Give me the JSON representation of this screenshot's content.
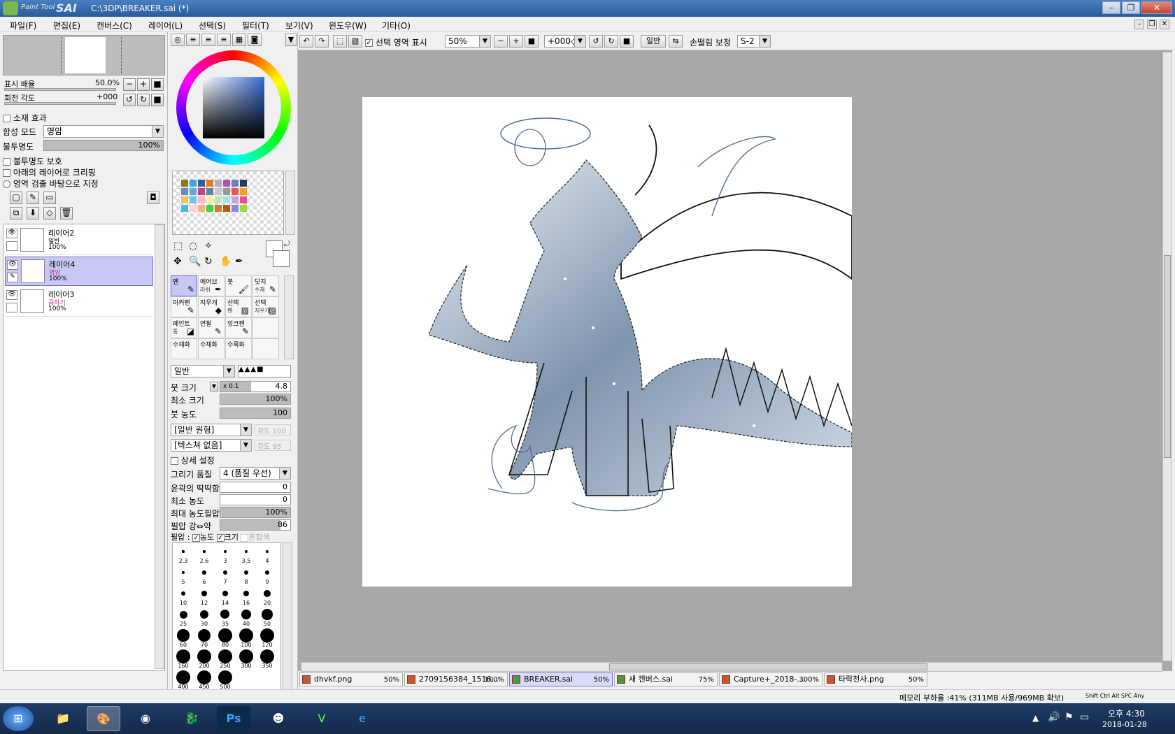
{
  "window": {
    "app": "SAI",
    "app_prefix": "Paint Tool",
    "path": "C:\\3DP\\BREAKER.sai (*)",
    "minimize": "–",
    "maximize": "❐",
    "close": "✕"
  },
  "menu": [
    "파일(F)",
    "편집(E)",
    "캔버스(C)",
    "레이어(L)",
    "선택(S)",
    "필터(T)",
    "보기(V)",
    "윈도우(W)",
    "기타(O)"
  ],
  "navigator": {
    "zoom_label": "표시 배율",
    "zoom_value": "50.0%",
    "rotate_label": "회전 각도",
    "rotate_value": "+000"
  },
  "layer_props": {
    "effects_label": "소재 효과",
    "blend_label": "합성 모드",
    "blend_value": "명암",
    "opacity_label": "불투명도",
    "opacity_value": "100%",
    "opacity_fraction": 1.0,
    "protect_label": "불투명도 보호",
    "clip_label": "아래의 레이어로 크리핑",
    "select_source_label": "영역 검출 바탕으로 지정"
  },
  "layers": [
    {
      "name": "레이어2",
      "mode": "일반",
      "opacity": "100%",
      "active": false
    },
    {
      "name": "레이어4",
      "mode": "명암",
      "opacity": "100%",
      "active": true
    },
    {
      "name": "레이어3",
      "mode": "곱하기",
      "opacity": "100%",
      "active": false
    }
  ],
  "tools": [
    {
      "label": "펜",
      "sub": "",
      "icon": "✎",
      "active": true
    },
    {
      "label": "에어브",
      "sub": "러쉬",
      "icon": "✒",
      "active": false
    },
    {
      "label": "붓",
      "sub": "",
      "icon": "🖌",
      "active": false
    },
    {
      "label": "닷지",
      "sub": "수채",
      "icon": "✎",
      "active": false
    },
    {
      "label": "마커펜",
      "sub": "",
      "icon": "✎",
      "active": false
    },
    {
      "label": "지우개",
      "sub": "",
      "icon": "◆",
      "active": false
    },
    {
      "label": "선택",
      "sub": "펜",
      "icon": "▨",
      "active": false
    },
    {
      "label": "선택",
      "sub": "지우개",
      "icon": "▨",
      "active": false
    },
    {
      "label": "페인트",
      "sub": "통",
      "icon": "◪",
      "active": false
    },
    {
      "label": "연필",
      "sub": "",
      "icon": "✎",
      "active": false
    },
    {
      "label": "잉크펜",
      "sub": "",
      "icon": "✎",
      "active": false
    },
    {
      "label": "",
      "sub": "",
      "icon": "",
      "active": false
    },
    {
      "label": "수채화",
      "sub": "",
      "icon": "",
      "active": false
    },
    {
      "label": "수채화",
      "sub": "",
      "icon": "",
      "active": false
    },
    {
      "label": "수묵화",
      "sub": "",
      "icon": "",
      "active": false
    },
    {
      "label": "",
      "sub": "",
      "icon": "",
      "active": false
    }
  ],
  "brush": {
    "mode": "일반",
    "size_label": "붓 크기",
    "size_mult": "x 0.1",
    "size_value": "4.8",
    "min_size_label": "최소 크기",
    "min_size_value": "100%",
    "density_label": "붓 농도",
    "density_value": "100",
    "shape": "[일반 원형]",
    "shape_strength_label": "강도",
    "shape_strength": "100",
    "texture": "[텍스쳐 없음]",
    "texture_strength_label": "강도",
    "texture_strength": "95",
    "detail_label": "상세 설정",
    "quality_label": "그리기 품질",
    "quality_value": "4 (품질 우선)",
    "edge_label": "윤곽의 딱딱함",
    "edge_value": "0",
    "min_density_label": "최소 농도",
    "min_density_value": "0",
    "max_pressure_label": "최대 농도필압",
    "max_pressure_value": "100%",
    "pressure_label": "필압 강⇔약",
    "pressure_value": "86",
    "pressure_fraction": 0.86,
    "pressure_opts_label": "필압 :",
    "pressure_density": "농도",
    "pressure_size": "크기",
    "pressure_mix": "혼합색"
  },
  "brush_sizes": [
    "2.3",
    "2.6",
    "3",
    "3.5",
    "4",
    "5",
    "6",
    "7",
    "8",
    "9",
    "10",
    "12",
    "14",
    "16",
    "20",
    "25",
    "30",
    "35",
    "40",
    "50",
    "60",
    "70",
    "80",
    "100",
    "120",
    "160",
    "200",
    "250",
    "300",
    "350",
    "400",
    "450",
    "500"
  ],
  "canvas_toolbar": {
    "show_selection": "선택 영역 표시",
    "zoom": "50%",
    "rotate": "+000◇",
    "mode": "일반",
    "stabilizer_label": "손떨림 보정",
    "stabilizer_value": "S-2"
  },
  "file_tabs": [
    {
      "name": "dhvkf.png",
      "zoom": "50%",
      "active": false
    },
    {
      "name": "2709156384_1516...",
      "zoom": "100%",
      "active": false
    },
    {
      "name": "BREAKER.sai",
      "zoom": "50%",
      "active": true
    },
    {
      "name": "새 캔버스.sai",
      "zoom": "75%",
      "active": false
    },
    {
      "name": "Capture+_2018-...",
      "zoom": "300%",
      "active": false
    },
    {
      "name": "타락천사.png",
      "zoom": "50%",
      "active": false
    }
  ],
  "status": {
    "memory": "메모리 부하율 :41% (311MB 사용/969MB 확보)",
    "keys": [
      "Shift",
      "Ctrl",
      "Alt",
      "SPC",
      "Any"
    ]
  },
  "taskbar": {
    "time": "오후 4:30",
    "date": "2018-01-28"
  },
  "colors": {
    "selected_layer": "#c8c8f4",
    "canvas_bg": "#a8a8a8",
    "title_bar": "#2b5a9a"
  }
}
